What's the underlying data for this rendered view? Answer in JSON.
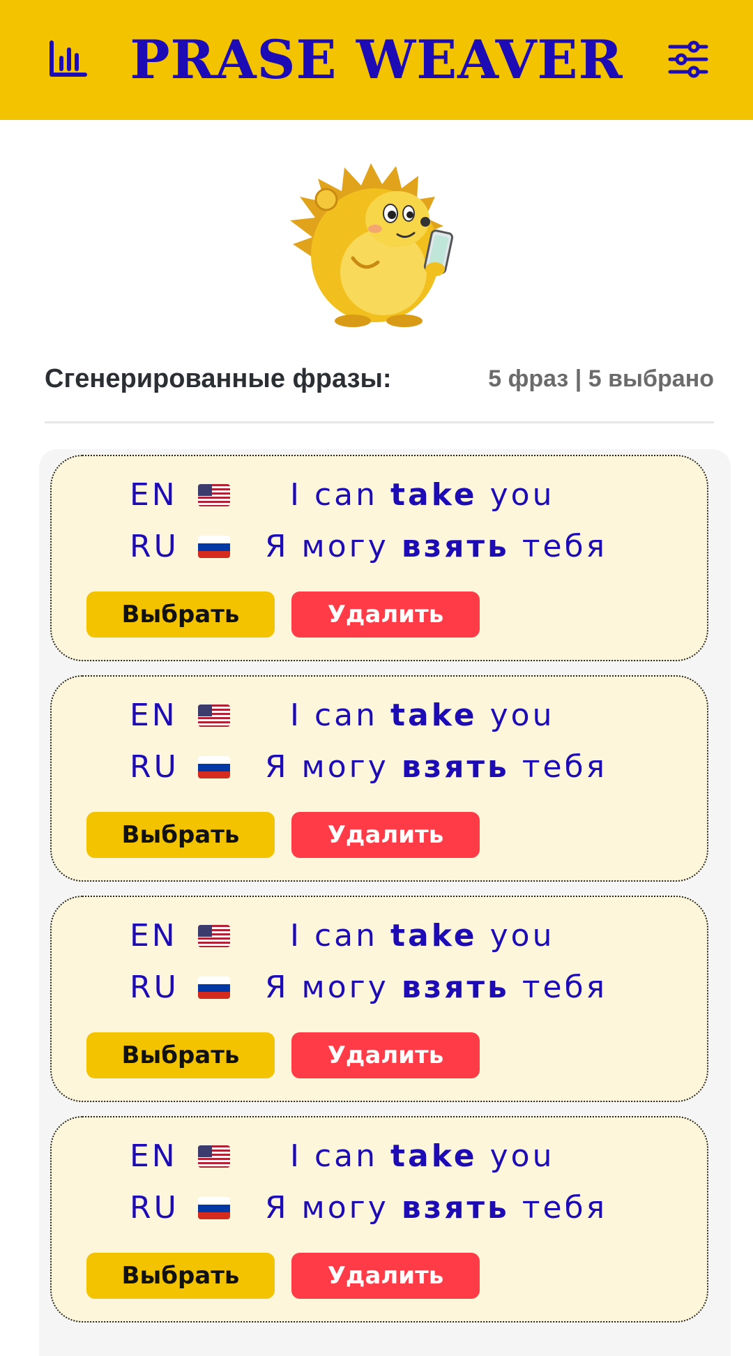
{
  "header": {
    "title": "PRASE WEAVER",
    "stats_icon": "bar-chart-icon",
    "settings_icon": "sliders-icon",
    "bg_color": "#F3C300",
    "title_color": "#1D0BB5"
  },
  "mascot": {
    "icon": "hedgehog-with-phone"
  },
  "section": {
    "label": "Сгенерированные фразы:",
    "count": "5 фраз | 5 выбрано"
  },
  "cards": [
    {
      "en": {
        "lang": "EN",
        "flag": "us-flag-icon",
        "before": "I can ",
        "bold": "take",
        "after": " you"
      },
      "ru": {
        "lang": "RU",
        "flag": "ru-flag-icon",
        "before": "Я могу ",
        "bold": "взять",
        "after": " тебя"
      },
      "select_label": "Выбрать",
      "delete_label": "Удалить"
    },
    {
      "en": {
        "lang": "EN",
        "flag": "us-flag-icon",
        "before": "I can ",
        "bold": "take",
        "after": " you"
      },
      "ru": {
        "lang": "RU",
        "flag": "ru-flag-icon",
        "before": "Я могу ",
        "bold": "взять",
        "after": " тебя"
      },
      "select_label": "Выбрать",
      "delete_label": "Удалить"
    },
    {
      "en": {
        "lang": "EN",
        "flag": "us-flag-icon",
        "before": "I can ",
        "bold": "take",
        "after": " you"
      },
      "ru": {
        "lang": "RU",
        "flag": "ru-flag-icon",
        "before": "Я могу ",
        "bold": "взять",
        "after": " тебя"
      },
      "select_label": "Выбрать",
      "delete_label": "Удалить"
    },
    {
      "en": {
        "lang": "EN",
        "flag": "us-flag-icon",
        "before": "I can ",
        "bold": "take",
        "after": " you"
      },
      "ru": {
        "lang": "RU",
        "flag": "ru-flag-icon",
        "before": "Я могу ",
        "bold": "взять",
        "after": " тебя"
      },
      "select_label": "Выбрать",
      "delete_label": "Удалить"
    }
  ],
  "colors": {
    "accent_yellow": "#F3C300",
    "delete_red": "#FF3B47",
    "text_blue": "#1D0BB5",
    "card_bg": "#FDF6DA"
  }
}
